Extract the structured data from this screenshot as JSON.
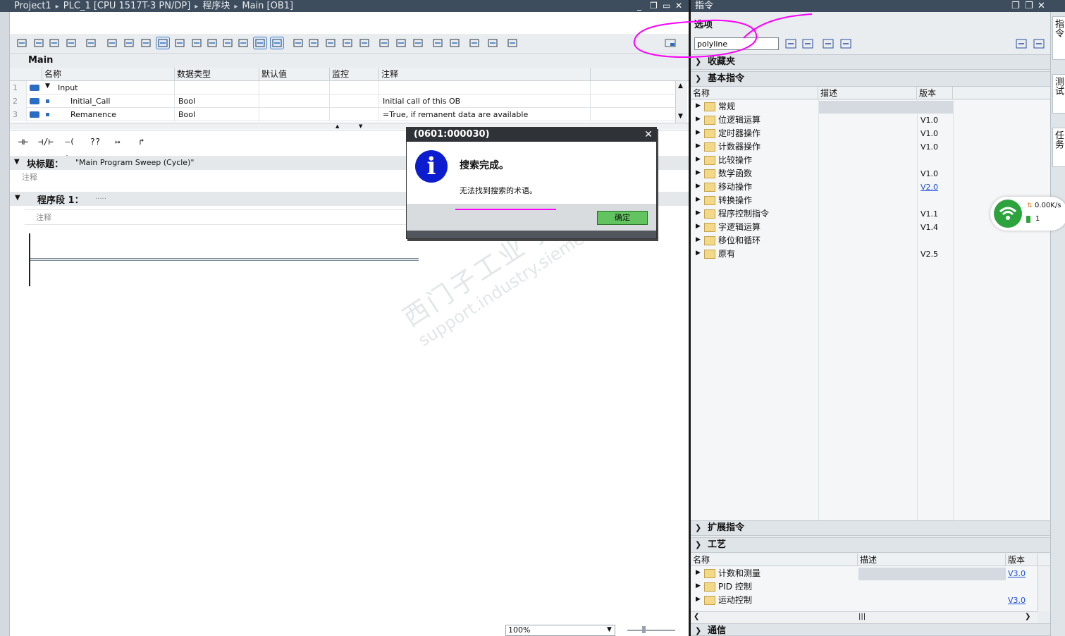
{
  "left_title": {
    "crumbs": [
      "Project1",
      "PLC_1 [CPU 1517T-3 PN/DP]",
      "程序块",
      "Main [OB1]"
    ],
    "separator": "▸",
    "controls": [
      "_",
      "❐",
      "✕"
    ]
  },
  "interface": {
    "block_name": "Main",
    "columns": [
      "名称",
      "数据类型",
      "默认值",
      "监控",
      "注释"
    ],
    "rows": [
      {
        "num": "1",
        "name": "Input",
        "type": "",
        "comment": ""
      },
      {
        "num": "2",
        "name": "Initial_Call",
        "type": "Bool",
        "comment": "Initial call of this OB"
      },
      {
        "num": "3",
        "name": "Remanence",
        "type": "Bool",
        "comment": "=True, if remanent data are available"
      }
    ]
  },
  "ladder_tools": [
    "⊣⊢",
    "⊣/⊢",
    "–( )–",
    "??",
    "↦",
    "↱"
  ],
  "block": {
    "title_label": "块标题：",
    "title_value": "\"Main Program Sweep (Cycle)\"",
    "comment_placeholder": "注释"
  },
  "network": {
    "label": "程序段 1：",
    "title_placeholder": ".....",
    "comment_placeholder": "注释"
  },
  "zoom": {
    "value": "100%"
  },
  "watermark": {
    "line1": "西门子工业 技术论坛",
    "line2": "support.industry.siemens.com/cs"
  },
  "instructions": {
    "title": "指令",
    "controls": [
      "❐",
      "❐",
      "✕"
    ],
    "options_label": "选项",
    "search_value": "polyline",
    "favorites_label": "收藏夹",
    "basic_label": "基本指令",
    "basic_columns": [
      "名称",
      "描述",
      "版本"
    ],
    "basic_items": [
      {
        "name": "常规",
        "version": "",
        "link": false
      },
      {
        "name": "位逻辑运算",
        "version": "V1.0",
        "link": false
      },
      {
        "name": "定时器操作",
        "version": "V1.0",
        "link": false
      },
      {
        "name": "计数器操作",
        "version": "V1.0",
        "link": false
      },
      {
        "name": "比较操作",
        "version": "",
        "link": false
      },
      {
        "name": "数学函数",
        "version": "V1.0",
        "link": false
      },
      {
        "name": "移动操作",
        "version": "V2.0",
        "link": true
      },
      {
        "name": "转换操作",
        "version": "",
        "link": false
      },
      {
        "name": "程序控制指令",
        "version": "V1.1",
        "link": false
      },
      {
        "name": "字逻辑运算",
        "version": "V1.4",
        "link": false
      },
      {
        "name": "移位和循环",
        "version": "",
        "link": false
      },
      {
        "name": "原有",
        "version": "V2.5",
        "link": false
      }
    ],
    "extended_label": "扩展指令",
    "tech_label": "工艺",
    "tech_columns": [
      "名称",
      "描述",
      "版本"
    ],
    "tech_items": [
      {
        "name": "计数和测量",
        "version": "V3.0",
        "link": true
      },
      {
        "name": "PID 控制",
        "version": "",
        "link": false
      },
      {
        "name": "运动控制",
        "version": "V3.0",
        "link": true
      }
    ],
    "comm_label": "通信"
  },
  "side_tabs": [
    "指令",
    "测试",
    "任务"
  ],
  "net_badge": {
    "speed": "0.00K/s",
    "count": "1"
  },
  "dialog": {
    "title": "(0601:000030)",
    "heading": "搜索完成。",
    "message": "无法找到搜索的术语。",
    "ok": "确定",
    "icon_glyph": "i",
    "close": "✕"
  },
  "colors": {
    "annotation": "#ff00ff",
    "accent": "#2c6dc4",
    "title_bar": "#3d4d5d",
    "ok_button": "#62c45e"
  }
}
